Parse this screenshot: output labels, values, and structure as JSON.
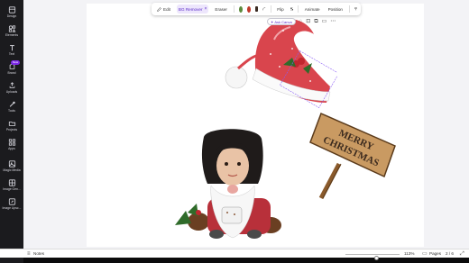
{
  "sidebar": {
    "items": [
      {
        "label": "Design",
        "icon": "design-icon"
      },
      {
        "label": "Elements",
        "icon": "elements-icon"
      },
      {
        "label": "Text",
        "icon": "text-icon"
      },
      {
        "label": "Brand",
        "icon": "brand-icon",
        "badge": "New"
      },
      {
        "label": "Uploads",
        "icon": "uploads-icon"
      },
      {
        "label": "Tools",
        "icon": "tools-icon"
      },
      {
        "label": "Projects",
        "icon": "projects-icon"
      },
      {
        "label": "Apps",
        "icon": "apps-icon"
      },
      {
        "label": "Magic Media",
        "icon": "magic-media-icon"
      },
      {
        "label": "Image Gen...",
        "icon": "image-gen-icon"
      },
      {
        "label": "Image Upsc...",
        "icon": "image-upscaler-icon"
      }
    ]
  },
  "toolbar": {
    "edit_label": "Edit",
    "bg_remover_label": "BG Remover",
    "eraser_label": "Eraser",
    "flip_label": "Flip",
    "animate_label": "Animate",
    "position_label": "Position",
    "colors": [
      "#5b8a3c",
      "#c0392b",
      "#3a2a22"
    ]
  },
  "context_bar": {
    "ask_canva_label": "Ask Canva"
  },
  "sign_text": {
    "line1": "MERRY",
    "line2": "CHRISTMAS"
  },
  "bottom_bar": {
    "notes_label": "Notes",
    "zoom_value": "113%",
    "zoom_level": 0.58,
    "pages_label": "Pages",
    "page_indicator": "2 / 6"
  },
  "accent": "#7d2ae8"
}
